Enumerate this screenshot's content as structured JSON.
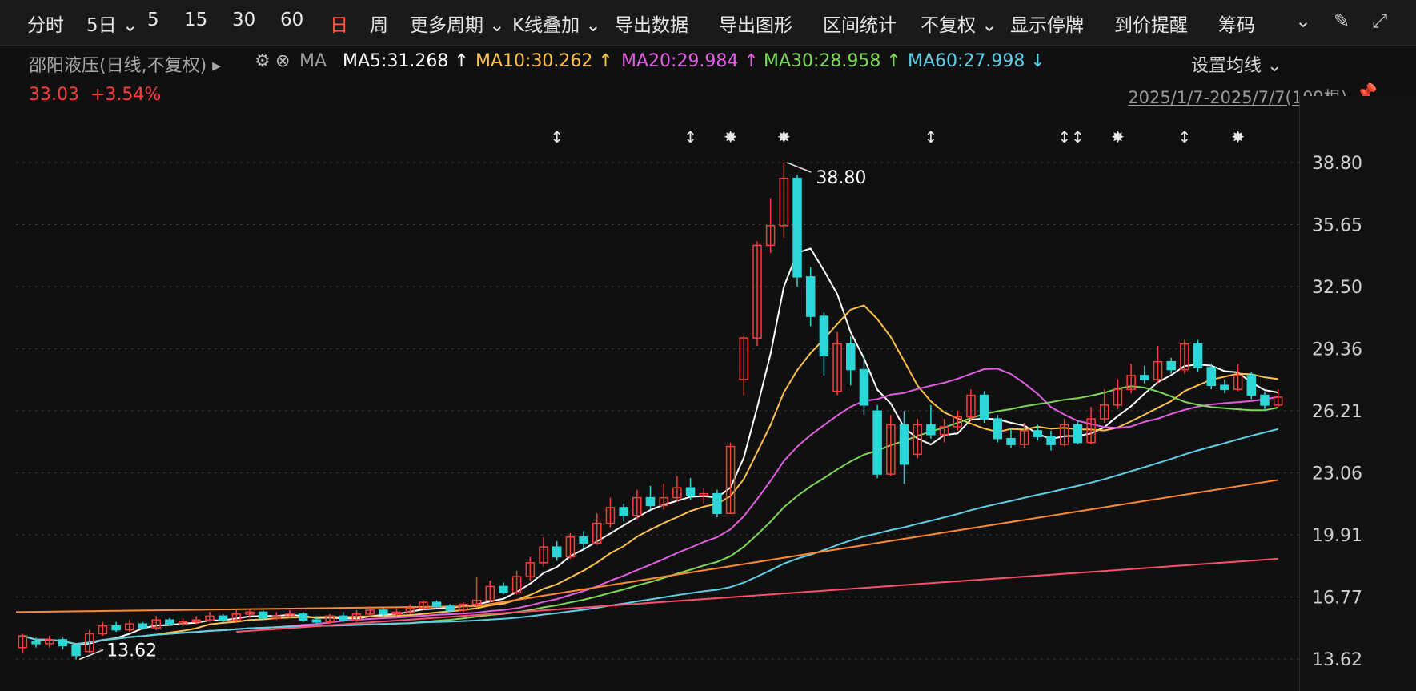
{
  "toolbar": {
    "items": [
      {
        "label": "分时"
      },
      {
        "label": "5日 ⌄"
      },
      {
        "label": "5"
      },
      {
        "label": "15"
      },
      {
        "label": "30"
      },
      {
        "label": "60"
      },
      {
        "label": "日"
      },
      {
        "label": "周"
      },
      {
        "label": "更多周期 ⌄"
      },
      {
        "label": "K线叠加 ⌄"
      },
      {
        "label": "导出数据"
      },
      {
        "label": "导出图形"
      },
      {
        "label": "区间统计"
      },
      {
        "label": "不复权 ⌄"
      },
      {
        "label": "显示停牌"
      },
      {
        "label": "到价提醒"
      },
      {
        "label": "筹码"
      }
    ],
    "active_index": 6
  },
  "legend": {
    "stock": "邵阳液压(日线,不复权) ▸",
    "ma_label": "MA",
    "ma5": "MA5:31.268 ↑",
    "ma10": "MA10:30.262 ↑",
    "ma20": "MA20:29.984 ↑",
    "ma30": "MA30:28.958 ↑",
    "ma60": "MA60:27.998 ↓",
    "settings": "设置均线 ⌄"
  },
  "price": {
    "last": "33.03",
    "change": "+3.54%"
  },
  "range": "2025/1/7-2025/7/7(109根)",
  "colors": {
    "up": "#ff3b3b",
    "down": "#2ad6d6",
    "ma5": "#ffffff",
    "ma10": "#ffc247",
    "ma20": "#e25ee2",
    "ma30": "#7ed957",
    "ma60": "#5fd0e6",
    "ma120": "#ff8a30",
    "ma250": "#ff4f6e"
  },
  "chart_data": {
    "type": "candlestick",
    "ylim": [
      13.62,
      38.8
    ],
    "y_ticks": [
      "38.80",
      "35.65",
      "32.50",
      "29.36",
      "26.21",
      "23.06",
      "19.91",
      "16.77",
      "13.62"
    ],
    "annotations": {
      "high": "38.80",
      "low": "13.62"
    },
    "candles": [
      [
        14.2,
        14.8,
        13.9,
        14.9
      ],
      [
        14.5,
        14.4,
        14.2,
        14.7
      ],
      [
        14.4,
        14.6,
        14.2,
        14.8
      ],
      [
        14.6,
        14.3,
        14.1,
        14.7
      ],
      [
        14.3,
        13.8,
        13.6,
        14.4
      ],
      [
        14.0,
        14.9,
        13.9,
        15.1
      ],
      [
        14.9,
        15.3,
        14.8,
        15.5
      ],
      [
        15.3,
        15.1,
        15.0,
        15.5
      ],
      [
        15.1,
        15.4,
        15.0,
        15.6
      ],
      [
        15.4,
        15.2,
        15.1,
        15.5
      ],
      [
        15.2,
        15.6,
        15.1,
        15.8
      ],
      [
        15.6,
        15.4,
        15.3,
        15.7
      ],
      [
        15.4,
        15.5,
        15.3,
        15.7
      ],
      [
        15.5,
        15.6,
        15.4,
        15.8
      ],
      [
        15.6,
        15.8,
        15.5,
        16.0
      ],
      [
        15.8,
        15.6,
        15.5,
        15.9
      ],
      [
        15.6,
        15.9,
        15.5,
        16.1
      ],
      [
        15.9,
        16.0,
        15.7,
        16.2
      ],
      [
        16.0,
        15.7,
        15.6,
        16.1
      ],
      [
        15.7,
        15.8,
        15.6,
        16.0
      ],
      [
        15.8,
        15.9,
        15.7,
        16.1
      ],
      [
        15.9,
        15.6,
        15.5,
        16.0
      ],
      [
        15.6,
        15.5,
        15.4,
        15.8
      ],
      [
        15.5,
        15.8,
        15.4,
        15.9
      ],
      [
        15.8,
        15.6,
        15.5,
        16.0
      ],
      [
        15.6,
        15.9,
        15.5,
        16.1
      ],
      [
        15.9,
        16.1,
        15.8,
        16.3
      ],
      [
        16.1,
        15.9,
        15.8,
        16.2
      ],
      [
        15.9,
        16.0,
        15.8,
        16.2
      ],
      [
        16.0,
        16.2,
        15.9,
        16.4
      ],
      [
        16.2,
        16.5,
        16.1,
        16.6
      ],
      [
        16.5,
        16.3,
        16.2,
        16.6
      ],
      [
        16.3,
        16.1,
        16.0,
        16.4
      ],
      [
        16.1,
        16.4,
        16.0,
        16.5
      ],
      [
        16.4,
        16.6,
        16.3,
        17.8
      ],
      [
        16.6,
        17.3,
        16.5,
        17.6
      ],
      [
        17.3,
        17.0,
        16.9,
        17.5
      ],
      [
        17.0,
        17.8,
        16.9,
        18.1
      ],
      [
        17.8,
        18.5,
        17.6,
        18.8
      ],
      [
        18.5,
        19.3,
        18.3,
        19.8
      ],
      [
        19.3,
        18.8,
        18.6,
        19.6
      ],
      [
        18.8,
        19.8,
        18.7,
        20.0
      ],
      [
        19.8,
        19.5,
        19.2,
        20.1
      ],
      [
        19.5,
        20.5,
        19.4,
        21.0
      ],
      [
        20.5,
        21.3,
        20.3,
        21.8
      ],
      [
        21.3,
        20.9,
        20.6,
        21.5
      ],
      [
        20.9,
        21.8,
        20.7,
        22.2
      ],
      [
        21.8,
        21.4,
        21.2,
        22.4
      ],
      [
        21.4,
        21.8,
        21.2,
        22.5
      ],
      [
        21.8,
        22.3,
        21.6,
        22.9
      ],
      [
        22.3,
        21.9,
        21.7,
        22.8
      ],
      [
        21.9,
        22.0,
        21.5,
        22.3
      ],
      [
        22.0,
        21.0,
        20.8,
        22.2
      ],
      [
        21.0,
        24.4,
        21.0,
        24.6
      ],
      [
        27.8,
        29.9,
        27.0,
        30.0
      ],
      [
        29.9,
        34.6,
        29.5,
        34.8
      ],
      [
        34.6,
        35.6,
        34.2,
        37.0
      ],
      [
        35.6,
        38.0,
        35.0,
        38.8
      ],
      [
        38.0,
        33.0,
        32.5,
        38.2
      ],
      [
        33.0,
        31.0,
        30.5,
        33.5
      ],
      [
        31.0,
        29.0,
        28.0,
        31.2
      ],
      [
        27.2,
        29.6,
        27.0,
        30.2
      ],
      [
        29.6,
        28.3,
        27.5,
        30.0
      ],
      [
        28.3,
        26.5,
        26.0,
        29.0
      ],
      [
        26.2,
        23.0,
        22.8,
        26.5
      ],
      [
        23.0,
        25.5,
        22.9,
        26.0
      ],
      [
        25.5,
        23.5,
        22.5,
        26.2
      ],
      [
        24.0,
        25.5,
        23.8,
        25.8
      ],
      [
        25.5,
        25.0,
        24.8,
        26.5
      ],
      [
        25.0,
        25.4,
        24.6,
        25.8
      ],
      [
        25.4,
        25.9,
        25.2,
        26.2
      ],
      [
        25.9,
        27.0,
        25.7,
        27.3
      ],
      [
        27.0,
        25.8,
        25.6,
        27.2
      ],
      [
        25.8,
        24.8,
        24.6,
        26.0
      ],
      [
        24.8,
        24.5,
        24.3,
        25.3
      ],
      [
        24.5,
        25.2,
        24.3,
        25.6
      ],
      [
        25.2,
        24.9,
        24.7,
        25.5
      ],
      [
        24.9,
        24.5,
        24.2,
        25.2
      ],
      [
        24.5,
        25.5,
        24.4,
        25.8
      ],
      [
        25.5,
        24.6,
        24.5,
        25.7
      ],
      [
        24.6,
        25.8,
        24.5,
        26.4
      ],
      [
        25.8,
        26.5,
        25.6,
        27.3
      ],
      [
        26.5,
        27.3,
        26.3,
        27.8
      ],
      [
        27.3,
        28.0,
        27.1,
        28.6
      ],
      [
        28.0,
        27.8,
        27.6,
        28.5
      ],
      [
        27.8,
        28.7,
        27.6,
        29.5
      ],
      [
        28.7,
        28.3,
        28.1,
        28.9
      ],
      [
        28.3,
        29.6,
        28.1,
        29.8
      ],
      [
        29.6,
        28.4,
        28.2,
        29.8
      ],
      [
        28.4,
        27.5,
        27.3,
        28.6
      ],
      [
        27.5,
        27.3,
        27.1,
        27.8
      ],
      [
        27.3,
        28.0,
        27.2,
        28.6
      ],
      [
        28.0,
        27.0,
        26.8,
        28.2
      ],
      [
        27.0,
        26.5,
        26.2,
        27.2
      ],
      [
        26.5,
        26.9,
        26.4,
        27.3
      ]
    ]
  }
}
